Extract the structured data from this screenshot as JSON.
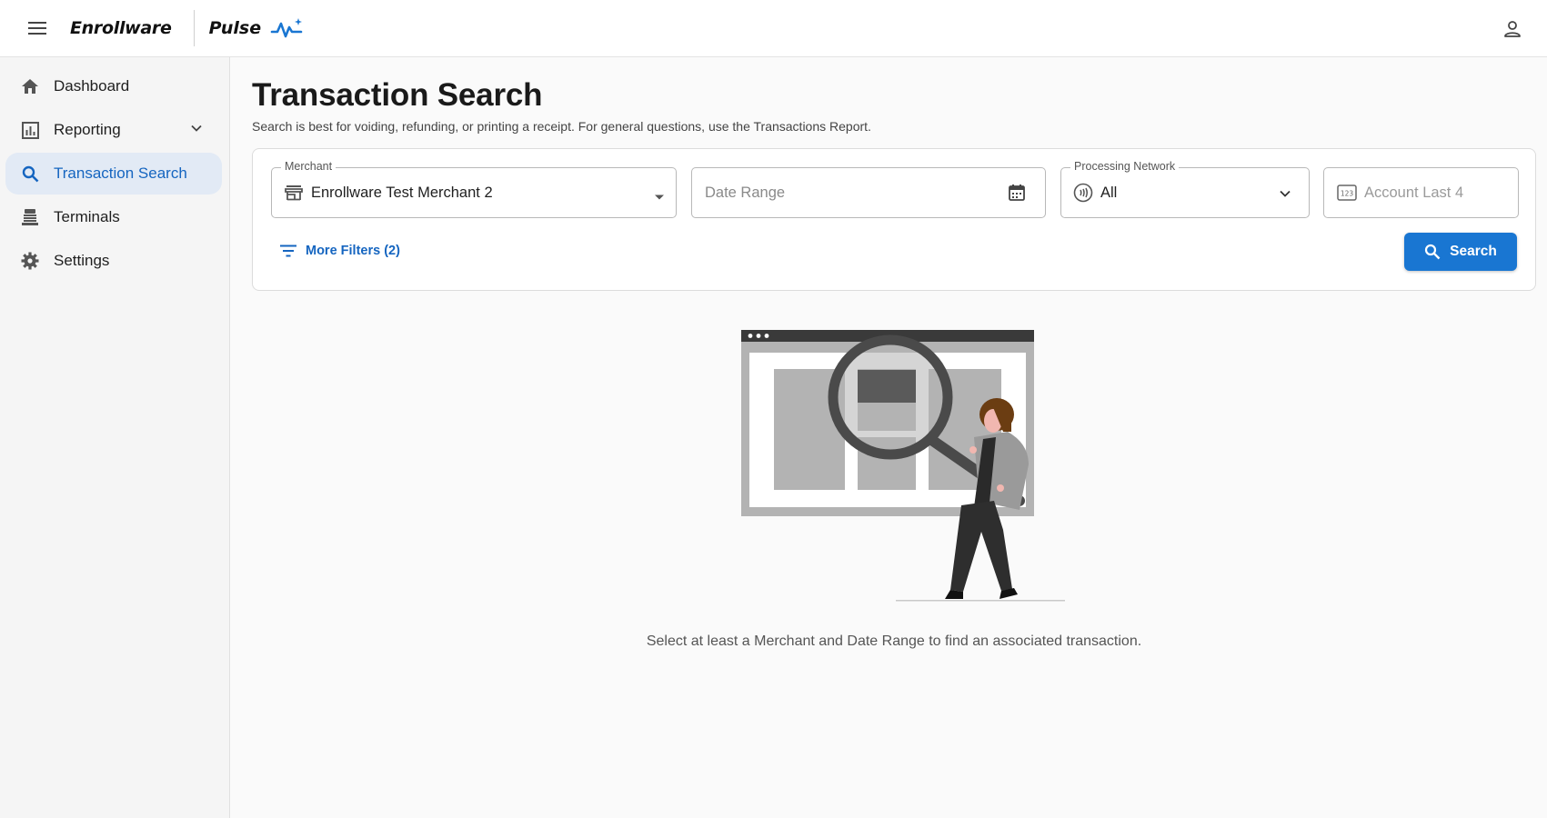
{
  "app": {
    "brand": "Enrollware",
    "product": "Pulse",
    "menu_icon": "hamburger-menu-icon",
    "user_icon": "account-icon",
    "accent_color": "#1976d2"
  },
  "sidebar": {
    "items": [
      {
        "label": "Dashboard",
        "icon": "home-icon",
        "active": false
      },
      {
        "label": "Reporting",
        "icon": "bar-chart-icon",
        "active": false,
        "expandable": true
      },
      {
        "label": "Transaction Search",
        "icon": "search-icon",
        "active": true
      },
      {
        "label": "Terminals",
        "icon": "terminal-icon",
        "active": false
      },
      {
        "label": "Settings",
        "icon": "gear-icon",
        "active": false
      }
    ]
  },
  "page": {
    "title": "Transaction Search",
    "subtitle": "Search is best for voiding, refunding, or printing a receipt. For general questions, use the Transactions Report."
  },
  "filters": {
    "merchant": {
      "label": "Merchant",
      "value": "Enrollware Test Merchant 2",
      "icon": "store-icon"
    },
    "date_range": {
      "placeholder": "Date Range",
      "icon": "calendar-icon"
    },
    "processing_network": {
      "label": "Processing Network",
      "value": "All",
      "icon": "contactless-icon"
    },
    "account_last4": {
      "placeholder": "Account Last 4",
      "icon": "numeric-123-icon"
    },
    "more_filters": {
      "label": "More Filters (2)",
      "icon": "filter-list-icon"
    },
    "search_button": {
      "label": "Search",
      "icon": "search-icon"
    }
  },
  "empty_state": {
    "illustration": "person-with-magnifying-glass-illustration",
    "message": "Select at least a Merchant and Date Range to find an associated transaction."
  }
}
